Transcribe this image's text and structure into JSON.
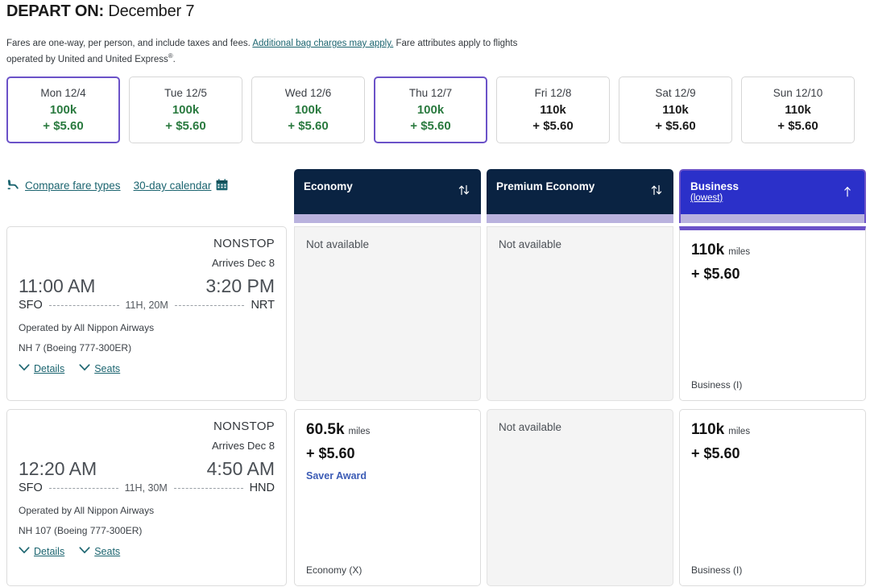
{
  "header": {
    "depart_label": "DEPART ON:",
    "depart_date": "December 7",
    "note_part1": "Fares are one-way, per person, and include taxes and fees.",
    "note_link": "Additional bag charges may apply.",
    "note_part2": "Fare attributes apply to flights operated by United and United Express",
    "note_sup": "®",
    "note_end": "."
  },
  "date_strip": {
    "tiles": [
      {
        "label": "Mon 12/4",
        "miles": "100k",
        "fee": "+ $5.60",
        "selected": true,
        "saver": true
      },
      {
        "label": "Tue 12/5",
        "miles": "100k",
        "fee": "+ $5.60",
        "selected": false,
        "saver": true
      },
      {
        "label": "Wed 12/6",
        "miles": "100k",
        "fee": "+ $5.60",
        "selected": false,
        "saver": true
      },
      {
        "label": "Thu 12/7",
        "miles": "100k",
        "fee": "+ $5.60",
        "selected": true,
        "saver": true
      },
      {
        "label": "Fri 12/8",
        "miles": "110k",
        "fee": "+ $5.60",
        "selected": false,
        "saver": false
      },
      {
        "label": "Sat 12/9",
        "miles": "110k",
        "fee": "+ $5.60",
        "selected": false,
        "saver": false
      },
      {
        "label": "Sun 12/10",
        "miles": "110k",
        "fee": "+ $5.60",
        "selected": false,
        "saver": false
      }
    ]
  },
  "links": {
    "compare_fare_types": "Compare fare types",
    "calendar_30day": "30-day calendar",
    "seat_icon": "seat-icon",
    "calendar_icon": "calendar-icon"
  },
  "columns": [
    {
      "id": "economy",
      "title": "Economy",
      "subtitle": "",
      "sort_icon": "sort-updown-icon",
      "highlighted": false
    },
    {
      "id": "premium",
      "title": "Premium Economy",
      "subtitle": "",
      "sort_icon": "sort-updown-icon",
      "highlighted": false
    },
    {
      "id": "business",
      "title": "Business",
      "subtitle": "(lowest)",
      "sort_icon": "sort-up-icon",
      "highlighted": true
    }
  ],
  "flights": [
    {
      "stops": "NONSTOP",
      "arrives": "Arrives Dec 8",
      "depart_time": "11:00 AM",
      "arrive_time": "3:20 PM",
      "origin": "SFO",
      "destination": "NRT",
      "duration": "11H, 20M",
      "operated_by": "Operated by All Nippon Airways",
      "equipment": "NH 7 (Boeing 777-300ER)",
      "details_label": "Details",
      "seats_label": "Seats",
      "fares": {
        "economy": {
          "available": false,
          "na_text": "Not available"
        },
        "premium": {
          "available": false,
          "na_text": "Not available"
        },
        "business": {
          "available": true,
          "miles": "110k",
          "miles_unit": "miles",
          "fee": "+ $5.60",
          "award_tag": "",
          "fare_class": "Business (I)"
        }
      }
    },
    {
      "stops": "NONSTOP",
      "arrives": "Arrives Dec 8",
      "depart_time": "12:20 AM",
      "arrive_time": "4:50 AM",
      "origin": "SFO",
      "destination": "HND",
      "duration": "11H, 30M",
      "operated_by": "Operated by All Nippon Airways",
      "equipment": "NH 107 (Boeing 777-300ER)",
      "details_label": "Details",
      "seats_label": "Seats",
      "fares": {
        "economy": {
          "available": true,
          "miles": "60.5k",
          "miles_unit": "miles",
          "fee": "+ $5.60",
          "award_tag": "Saver Award",
          "fare_class": "Economy (X)"
        },
        "premium": {
          "available": false,
          "na_text": "Not available"
        },
        "business": {
          "available": true,
          "miles": "110k",
          "miles_unit": "miles",
          "fee": "+ $5.60",
          "award_tag": "",
          "fare_class": "Business (I)"
        }
      }
    }
  ],
  "colors": {
    "header_navy": "#0a2342",
    "highlight_blue": "#2b30c9",
    "accent_purple": "#6b52c8",
    "link_teal": "#1c6570",
    "saver_green": "#2a7a3f",
    "award_blue": "#3b5bb5",
    "underbar_lavender": "#b9b2de"
  }
}
